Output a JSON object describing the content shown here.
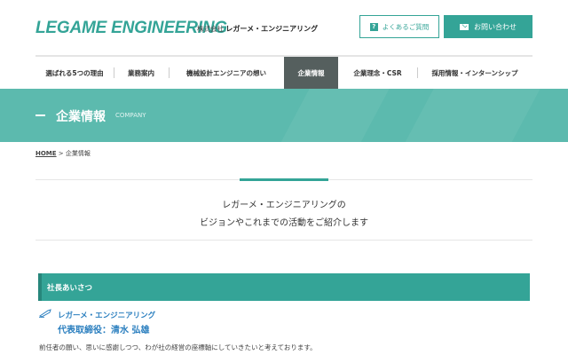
{
  "header": {
    "logo_text": "LEGAME ENGINEERING",
    "logo_sub_prefix": "株式会社",
    "logo_sub_name": "レガーメ・エンジニアリング",
    "faq_label": "よくあるご質問",
    "contact_label": "お問い合わせ"
  },
  "nav": {
    "items": [
      "選ばれる5つの理由",
      "業務案内",
      "機械設計エンジニアの想い",
      "企業情報",
      "企業理念・CSR",
      "採用情報・インターンシップ"
    ],
    "active_index": 3
  },
  "banner": {
    "title": "企業情報",
    "subtitle": "COMPANY"
  },
  "breadcrumb": {
    "home": "HOME",
    "separator": ">",
    "current": "企業情報"
  },
  "intro": {
    "line1": "レガーメ・エンジニアリングの",
    "line2": "ビジョンやこれまでの活動をご紹介します"
  },
  "section": {
    "title": "社長あいさつ",
    "company": "レガーメ・エンジニアリング",
    "president": "代表取締役：清水 弘雄",
    "greeting": "前任者の願い、思いに感謝しつつ、わが社の経営の座標軸にしていきたいと考えております。"
  },
  "colors": {
    "brand": "#34a497",
    "banner": "#5cbaae",
    "nav_active": "#555f5e",
    "link_blue": "#2b7fbf"
  },
  "icons": {
    "faq": "question-icon",
    "contact": "mail-icon",
    "heading": "pen-icon"
  }
}
